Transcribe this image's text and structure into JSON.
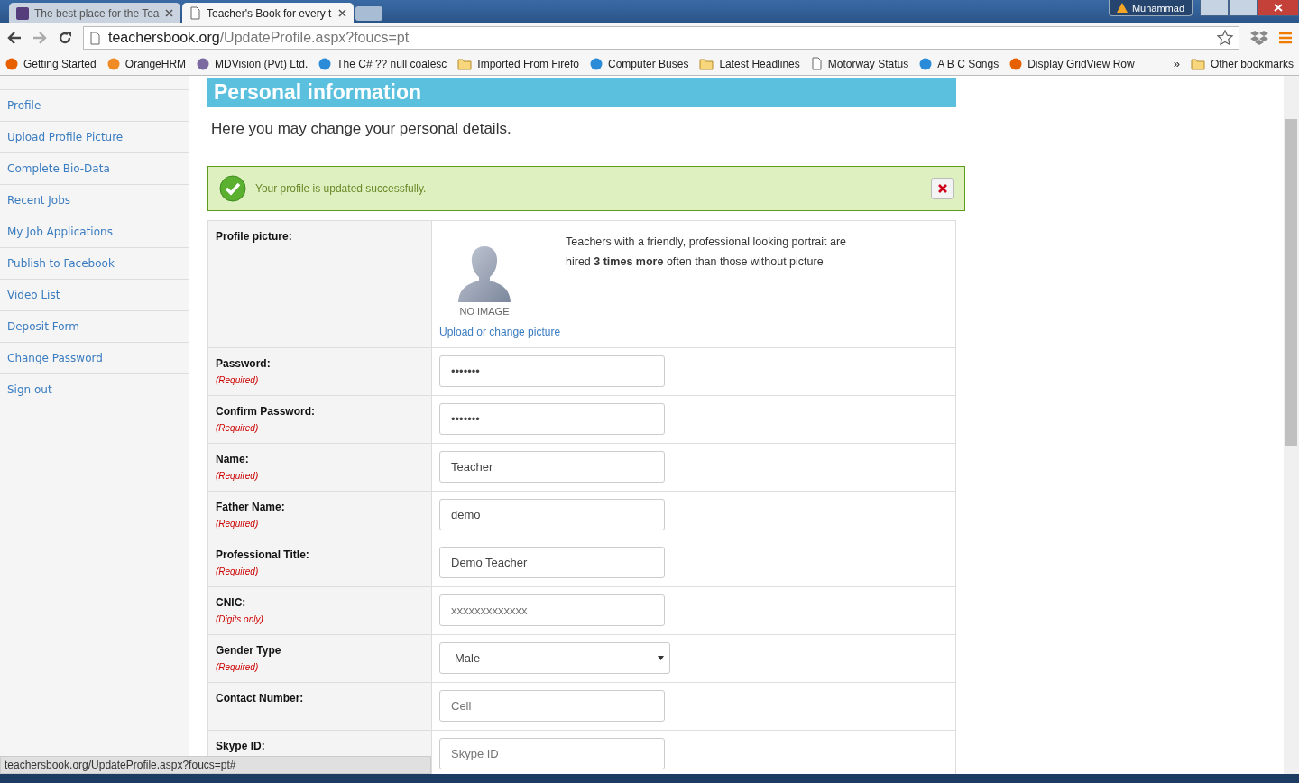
{
  "browser": {
    "tabs": [
      {
        "title": "The best place for the Tea",
        "selected": false,
        "kind": "site"
      },
      {
        "title": "Teacher's Book for every t",
        "selected": true,
        "kind": "page"
      }
    ],
    "user": "Muhammad",
    "address": {
      "host": "teachersbook.org",
      "path": "/UpdateProfile.aspx?foucs=pt"
    },
    "bookmarks": [
      {
        "label": "Getting Started",
        "kind": "site"
      },
      {
        "label": "OrangeHRM",
        "kind": "site"
      },
      {
        "label": "MDVision (Pvt) Ltd.",
        "kind": "site"
      },
      {
        "label": "The C# ?? null coalesc",
        "kind": "site"
      },
      {
        "label": "Imported From Firefo",
        "kind": "folder"
      },
      {
        "label": "Computer Buses",
        "kind": "site"
      },
      {
        "label": "Latest Headlines",
        "kind": "folder"
      },
      {
        "label": "Motorway Status",
        "kind": "page"
      },
      {
        "label": "A B C Songs",
        "kind": "site"
      },
      {
        "label": "Display GridView Row",
        "kind": "site"
      }
    ],
    "overflow": "»",
    "other_bookmarks": "Other bookmarks"
  },
  "sidebar": {
    "items": [
      {
        "label": "Profile"
      },
      {
        "label": "Upload Profile Picture"
      },
      {
        "label": "Complete Bio-Data"
      },
      {
        "label": "Recent Jobs"
      },
      {
        "label": "My Job Applications"
      },
      {
        "label": "Publish to Facebook"
      },
      {
        "label": "Video List"
      },
      {
        "label": "Deposit Form"
      },
      {
        "label": "Change Password"
      },
      {
        "label": "Sign out"
      }
    ]
  },
  "page": {
    "heading": "Personal information",
    "intro": "Here you may change your personal details.",
    "alert": {
      "message": "Your profile is updated successfully."
    },
    "form": [
      {
        "kind": "picture",
        "label": "Profile picture:",
        "no_image": "NO IMAGE",
        "link": "Upload or change picture",
        "tip": "Teachers with a friendly, professional looking portrait are hired **3 times more** often than those without picture"
      },
      {
        "kind": "input",
        "label": "Password:",
        "note": "(Required)",
        "value": "•••••••"
      },
      {
        "kind": "input",
        "label": "Confirm Password:",
        "note": "(Required)",
        "value": "•••••••"
      },
      {
        "kind": "input",
        "label": "Name:",
        "note": "(Required)",
        "value": "Teacher"
      },
      {
        "kind": "input",
        "label": "Father Name:",
        "note": "(Required)",
        "value": "demo"
      },
      {
        "kind": "input",
        "label": "Professional Title:",
        "note": "(Required)",
        "value": "Demo Teacher"
      },
      {
        "kind": "input",
        "label": "CNIC:",
        "note": "(Digits only)",
        "placeholder": "xxxxxxxxxxxxx"
      },
      {
        "kind": "select",
        "label": "Gender Type",
        "note": "(Required)",
        "value": "Male"
      },
      {
        "kind": "input",
        "label": "Contact Number:",
        "placeholder": "Cell"
      },
      {
        "kind": "input",
        "label": "Skype ID:",
        "placeholder": "Skype ID"
      }
    ]
  },
  "status_url": "teachersbook.org/UpdateProfile.aspx?foucs=pt#"
}
